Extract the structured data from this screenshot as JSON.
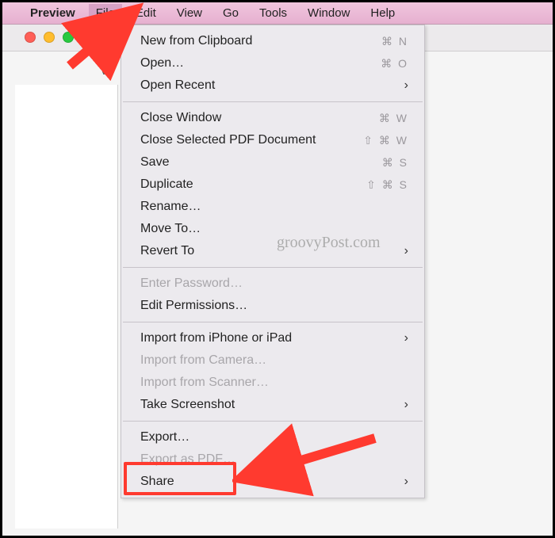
{
  "menubar": {
    "app_name": "Preview",
    "items": [
      "File",
      "Edit",
      "View",
      "Go",
      "Tools",
      "Window",
      "Help"
    ],
    "active_index": 0
  },
  "toolbar": {
    "hint": "Vi"
  },
  "dropdown": {
    "groups": [
      [
        {
          "label": "New from Clipboard",
          "shortcut": "⌘ N"
        },
        {
          "label": "Open…",
          "shortcut": "⌘ O"
        },
        {
          "label": "Open Recent",
          "submenu": true
        }
      ],
      [
        {
          "label": "Close Window",
          "shortcut": "⌘ W"
        },
        {
          "label": "Close Selected PDF Document",
          "shortcut": "⇧ ⌘ W"
        },
        {
          "label": "Save",
          "shortcut": "⌘ S"
        },
        {
          "label": "Duplicate",
          "shortcut": "⇧ ⌘ S"
        },
        {
          "label": "Rename…"
        },
        {
          "label": "Move To…"
        },
        {
          "label": "Revert To",
          "submenu": true
        }
      ],
      [
        {
          "label": "Enter Password…",
          "disabled": true
        },
        {
          "label": "Edit Permissions…"
        }
      ],
      [
        {
          "label": "Import from iPhone or iPad",
          "submenu": true
        },
        {
          "label": "Import from Camera…",
          "disabled": true
        },
        {
          "label": "Import from Scanner…",
          "disabled": true
        },
        {
          "label": "Take Screenshot",
          "submenu": true
        }
      ],
      [
        {
          "label": "Export…"
        },
        {
          "label": "Export as PDF…",
          "disabled": true
        },
        {
          "label": "Share",
          "submenu": true
        }
      ]
    ]
  },
  "watermark": "groovyPost.com"
}
